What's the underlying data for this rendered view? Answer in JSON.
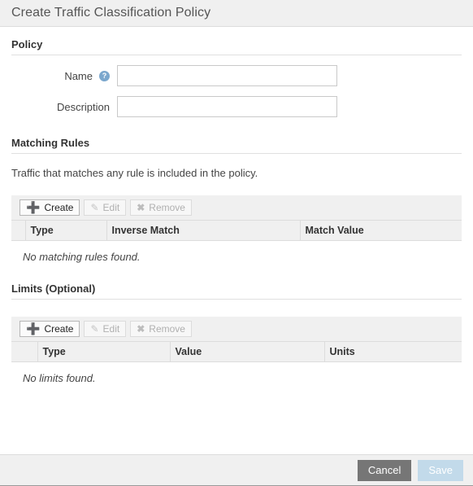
{
  "dialog": {
    "title": "Create Traffic Classification Policy"
  },
  "policy_section": {
    "heading": "Policy",
    "fields": [
      {
        "label": "Name",
        "value": "",
        "placeholder": "",
        "help_icon": "help-circle-icon",
        "has_help": true
      },
      {
        "label": "Description",
        "value": "",
        "placeholder": "",
        "has_help": false
      }
    ]
  },
  "matching_rules_section": {
    "heading": "Matching Rules",
    "helper_text": "Traffic that matches any rule is included in the policy.",
    "toolbar": {
      "create_label": "Create",
      "create_icon": "plus-icon",
      "edit_label": "Edit",
      "edit_icon": "pencil-icon",
      "remove_label": "Remove",
      "remove_icon": "cross-icon"
    },
    "table": {
      "columns": [
        "",
        "Type",
        "Inverse Match",
        "Match Value"
      ],
      "rows": [],
      "empty_message": "No matching rules found."
    }
  },
  "limits_section": {
    "heading": "Limits (Optional)",
    "toolbar": {
      "create_label": "Create",
      "create_icon": "plus-icon",
      "edit_label": "Edit",
      "edit_icon": "pencil-icon",
      "remove_label": "Remove",
      "remove_icon": "cross-icon"
    },
    "table": {
      "columns": [
        "",
        "Type",
        "Value",
        "Units"
      ],
      "rows": [],
      "empty_message": "No limits found."
    }
  },
  "footer": {
    "cancel_label": "Cancel",
    "save_label": "Save",
    "save_enabled": false
  },
  "colors": {
    "titlebar_bg": "#f0f0f0",
    "toolbar_bg": "#f0f0f0",
    "header_bg": "#f0f0f0",
    "help_icon": "#7ba7cd",
    "cancel_bg": "#767676",
    "save_bg": "#c2daea",
    "border": "#dcdcdc"
  }
}
